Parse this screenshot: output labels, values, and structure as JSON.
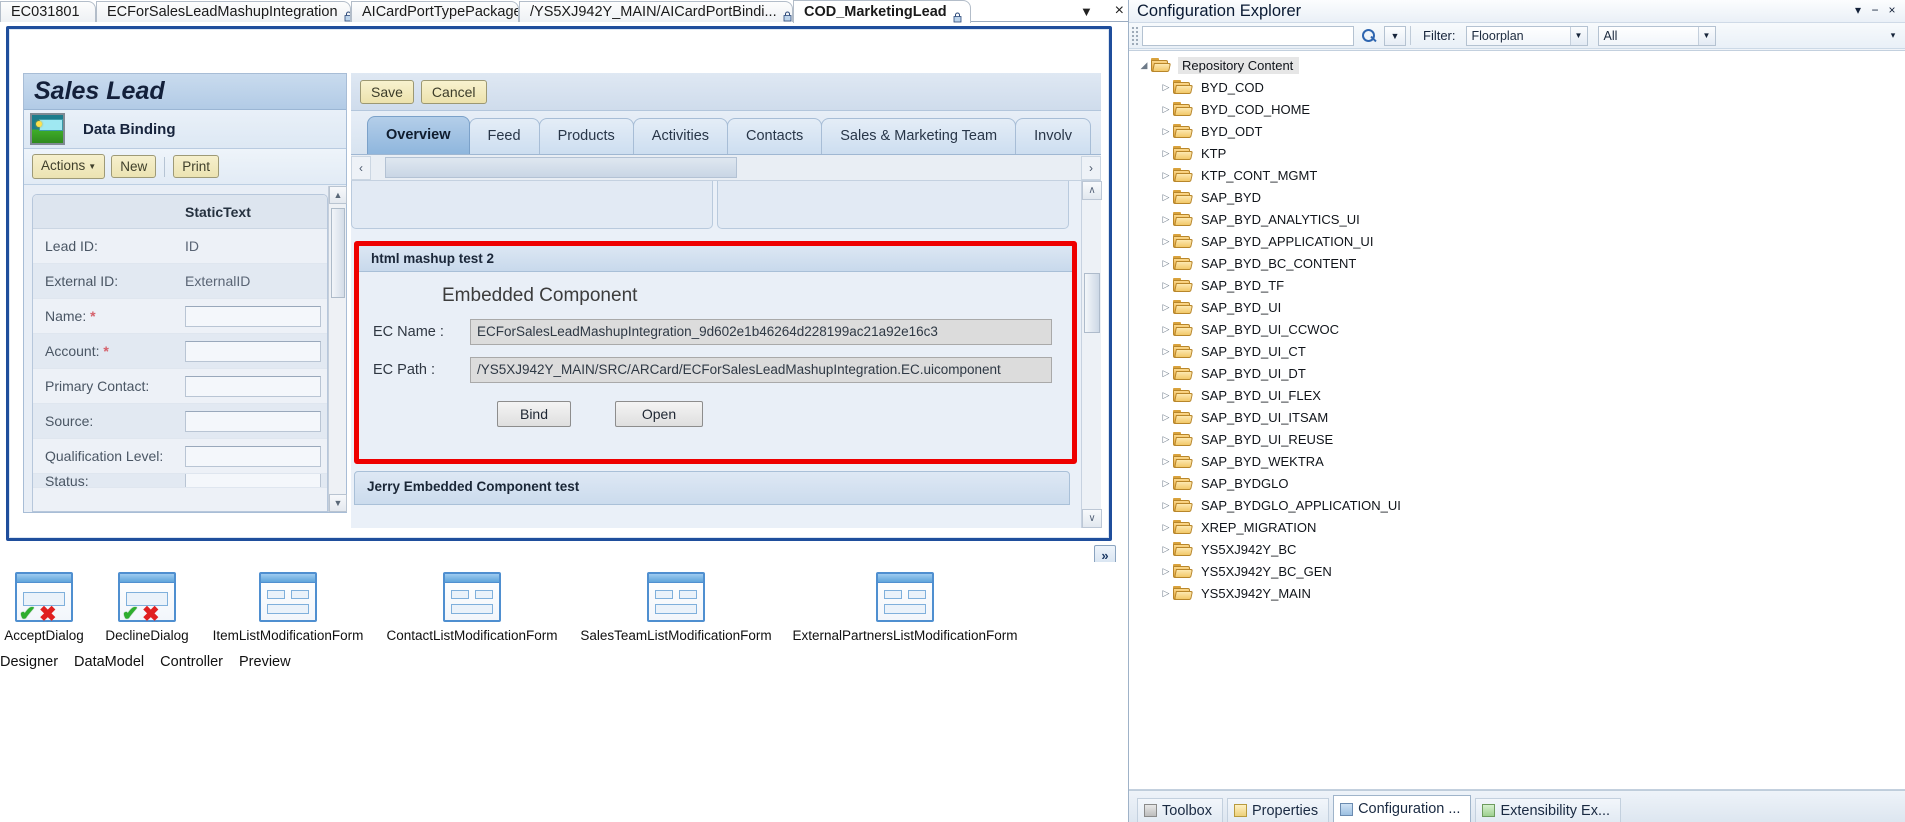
{
  "editor_tabs": [
    {
      "label": "EC031801",
      "locked": false,
      "active": false
    },
    {
      "label": "ECForSalesLeadMashupIntegration",
      "locked": true,
      "active": false
    },
    {
      "label": "AICardPortTypePackage",
      "locked": true,
      "active": false
    },
    {
      "label": "/YS5XJ942Y_MAIN/AICardPortBindi...",
      "locked": true,
      "active": false
    },
    {
      "label": "COD_MarketingLead",
      "locked": true,
      "active": true
    }
  ],
  "tabstrip_controls": {
    "dropdown_icon": "chevron-down-icon",
    "close_icon": "close-icon",
    "dropdown_glyph": "▼",
    "close_glyph": "×"
  },
  "sales_lead": {
    "title": "Sales Lead",
    "subtitle": "Data Binding",
    "icon": "data-binding-icon",
    "toolbar": {
      "actions": "Actions",
      "actions_caret": "▼",
      "new": "New",
      "print": "Print"
    },
    "table": {
      "header_label": "",
      "header_value": "StaticText",
      "rows": [
        {
          "label": "Lead ID:",
          "required": false,
          "static": "ID",
          "type": "static"
        },
        {
          "label": "External ID:",
          "required": false,
          "static": "ExternalID",
          "type": "static"
        },
        {
          "label": "Name:",
          "required": true,
          "static": "",
          "type": "input"
        },
        {
          "label": "Account:",
          "required": true,
          "static": "",
          "type": "input"
        },
        {
          "label": "Primary Contact:",
          "required": false,
          "static": "",
          "type": "input"
        },
        {
          "label": "Source:",
          "required": false,
          "static": "",
          "type": "input"
        },
        {
          "label": "Qualification Level:",
          "required": false,
          "static": "",
          "type": "input"
        },
        {
          "label": "Status:",
          "required": false,
          "static": "",
          "type": "input"
        }
      ],
      "required_marker": "*"
    },
    "scroll_up_glyph": "▲",
    "scroll_down_glyph": "▼"
  },
  "content": {
    "toolbar": {
      "save": "Save",
      "cancel": "Cancel"
    },
    "tabs": [
      {
        "label": "Overview",
        "active": true
      },
      {
        "label": "Feed",
        "active": false
      },
      {
        "label": "Products",
        "active": false
      },
      {
        "label": "Activities",
        "active": false
      },
      {
        "label": "Contacts",
        "active": false
      },
      {
        "label": "Sales & Marketing Team",
        "active": false
      },
      {
        "label": "Involv",
        "active": false
      }
    ],
    "pager": {
      "left_glyph": "‹",
      "right_glyph": "›"
    },
    "scroll_up_glyph": "∧",
    "scroll_down_glyph": "∨",
    "mashup": {
      "section_title": "html mashup test 2",
      "heading": "Embedded Component",
      "fields": [
        {
          "label": "EC Name :",
          "value": "ECForSalesLeadMashupIntegration_9d602e1b46264d228199ac21a92e16c3"
        },
        {
          "label": "EC Path :",
          "value": "/YS5XJ942Y_MAIN/SRC/ARCard/ECForSalesLeadMashupIntegration.EC.uicomponent"
        }
      ],
      "buttons": {
        "bind": "Bind",
        "open": "Open"
      },
      "highlight_color": "#ee0000"
    },
    "jerry_section_title": "Jerry Embedded Component test"
  },
  "collapse_button": {
    "glyph": "»",
    "name": "collapse-panel-button"
  },
  "shelf": [
    {
      "label": "AcceptDialog",
      "icon": "accept-dialog-icon",
      "variant": "dialog-check-x"
    },
    {
      "label": "DeclineDialog",
      "icon": "decline-dialog-icon",
      "variant": "dialog-check-x"
    },
    {
      "label": "ItemListModificationForm",
      "icon": "item-list-form-icon",
      "variant": "form"
    },
    {
      "label": "ContactListModificationForm",
      "icon": "contact-list-form-icon",
      "variant": "form"
    },
    {
      "label": "SalesTeamListModificationForm",
      "icon": "sales-team-list-form-icon",
      "variant": "form"
    },
    {
      "label": "ExternalPartnersListModificationForm",
      "icon": "external-partners-list-form-icon",
      "variant": "form"
    }
  ],
  "designer_tabs": [
    {
      "label": "Designer",
      "active": true
    },
    {
      "label": "DataModel",
      "active": false
    },
    {
      "label": "Controller",
      "active": false
    },
    {
      "label": "Preview",
      "active": false
    }
  ],
  "config_explorer": {
    "title": "Configuration Explorer",
    "title_buttons": {
      "pin_glyph": "▾",
      "minimize_glyph": "−",
      "close_glyph": "×"
    },
    "search": {
      "value": "",
      "placeholder": ""
    },
    "search_icon": "search-icon",
    "dropdown_glyph": "▼",
    "filter_label": "Filter:",
    "filter_value": "Floorplan",
    "scope_value": "All",
    "more_glyph": "▾",
    "tree": {
      "root": {
        "label": "Repository Content",
        "expanded": true
      },
      "items": [
        {
          "label": "BYD_COD"
        },
        {
          "label": "BYD_COD_HOME"
        },
        {
          "label": "BYD_ODT"
        },
        {
          "label": "KTP"
        },
        {
          "label": "KTP_CONT_MGMT"
        },
        {
          "label": "SAP_BYD"
        },
        {
          "label": "SAP_BYD_ANALYTICS_UI"
        },
        {
          "label": "SAP_BYD_APPLICATION_UI"
        },
        {
          "label": "SAP_BYD_BC_CONTENT"
        },
        {
          "label": "SAP_BYD_TF"
        },
        {
          "label": "SAP_BYD_UI"
        },
        {
          "label": "SAP_BYD_UI_CCWOC"
        },
        {
          "label": "SAP_BYD_UI_CT"
        },
        {
          "label": "SAP_BYD_UI_DT"
        },
        {
          "label": "SAP_BYD_UI_FLEX"
        },
        {
          "label": "SAP_BYD_UI_ITSAM"
        },
        {
          "label": "SAP_BYD_UI_REUSE"
        },
        {
          "label": "SAP_BYD_WEKTRA"
        },
        {
          "label": "SAP_BYDGLO"
        },
        {
          "label": "SAP_BYDGLO_APPLICATION_UI"
        },
        {
          "label": "XREP_MIGRATION"
        },
        {
          "label": "YS5XJ942Y_BC"
        },
        {
          "label": "YS5XJ942Y_BC_GEN"
        },
        {
          "label": "YS5XJ942Y_MAIN"
        }
      ],
      "collapsed_glyph": "▷",
      "expanded_glyph": "◢"
    },
    "dock_tabs": [
      {
        "label": "Toolbox",
        "active": false,
        "icon": "toolbox-icon"
      },
      {
        "label": "Properties",
        "active": false,
        "icon": "properties-icon"
      },
      {
        "label": "Configuration ...",
        "active": true,
        "icon": "configuration-icon"
      },
      {
        "label": "Extensibility Ex...",
        "active": false,
        "icon": "extensibility-icon"
      }
    ]
  }
}
